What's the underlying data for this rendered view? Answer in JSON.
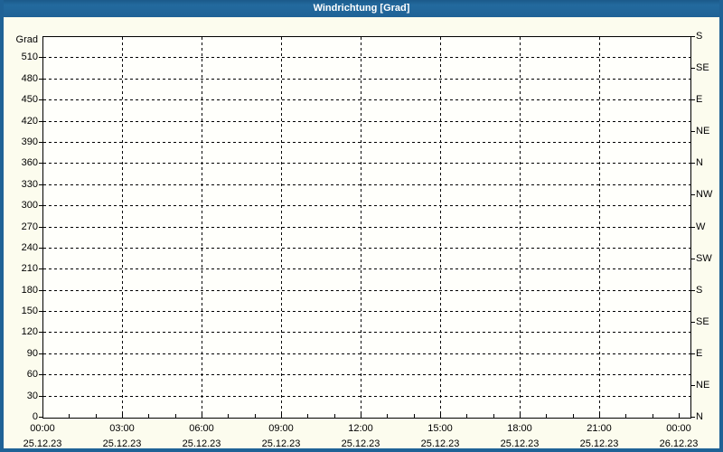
{
  "header": {
    "title": "Windrichtung [Grad]"
  },
  "colors": {
    "accent_blue": "#1f6296",
    "page_bg": "#fcfcee",
    "plot_bg": "#fffffb",
    "grid": "#000000",
    "title_text": "#ffffff",
    "label_text": "#000000"
  },
  "chart_data": {
    "type": "line",
    "title": "Windrichtung [Grad]",
    "grid": "dashed",
    "plot_empty": true,
    "series": [],
    "y_left": {
      "unit_label": "Grad",
      "range": [
        0,
        540
      ],
      "tick_interval": 30,
      "ticks": [
        0,
        30,
        60,
        90,
        120,
        150,
        180,
        210,
        240,
        270,
        300,
        330,
        360,
        390,
        420,
        450,
        480,
        510
      ]
    },
    "y_right": {
      "tick_interval": 45,
      "ticks": [
        {
          "value": 0,
          "label": "N"
        },
        {
          "value": 45,
          "label": "NE"
        },
        {
          "value": 90,
          "label": "E"
        },
        {
          "value": 135,
          "label": "SE"
        },
        {
          "value": 180,
          "label": "S"
        },
        {
          "value": 225,
          "label": "SW"
        },
        {
          "value": 270,
          "label": "W"
        },
        {
          "value": 315,
          "label": "NW"
        },
        {
          "value": 360,
          "label": "N"
        },
        {
          "value": 405,
          "label": "NE"
        },
        {
          "value": 450,
          "label": "E"
        },
        {
          "value": 495,
          "label": "SE"
        },
        {
          "value": 540,
          "label": "S"
        }
      ]
    },
    "x_axis": {
      "range_hours": [
        0,
        24.4
      ],
      "minor_interval_hours": 1,
      "gridline_hours": [
        3,
        6,
        9,
        12,
        15,
        18,
        21
      ],
      "major_ticks": [
        {
          "hour": 0,
          "time": "00:00",
          "date": "25.12.23"
        },
        {
          "hour": 3,
          "time": "03:00",
          "date": "25.12.23"
        },
        {
          "hour": 6,
          "time": "06:00",
          "date": "25.12.23"
        },
        {
          "hour": 9,
          "time": "09:00",
          "date": "25.12.23"
        },
        {
          "hour": 12,
          "time": "12:00",
          "date": "25.12.23"
        },
        {
          "hour": 15,
          "time": "15:00",
          "date": "25.12.23"
        },
        {
          "hour": 18,
          "time": "18:00",
          "date": "25.12.23"
        },
        {
          "hour": 21,
          "time": "21:00",
          "date": "25.12.23"
        },
        {
          "hour": 24,
          "time": "00:00",
          "date": "26.12.23"
        }
      ]
    }
  }
}
